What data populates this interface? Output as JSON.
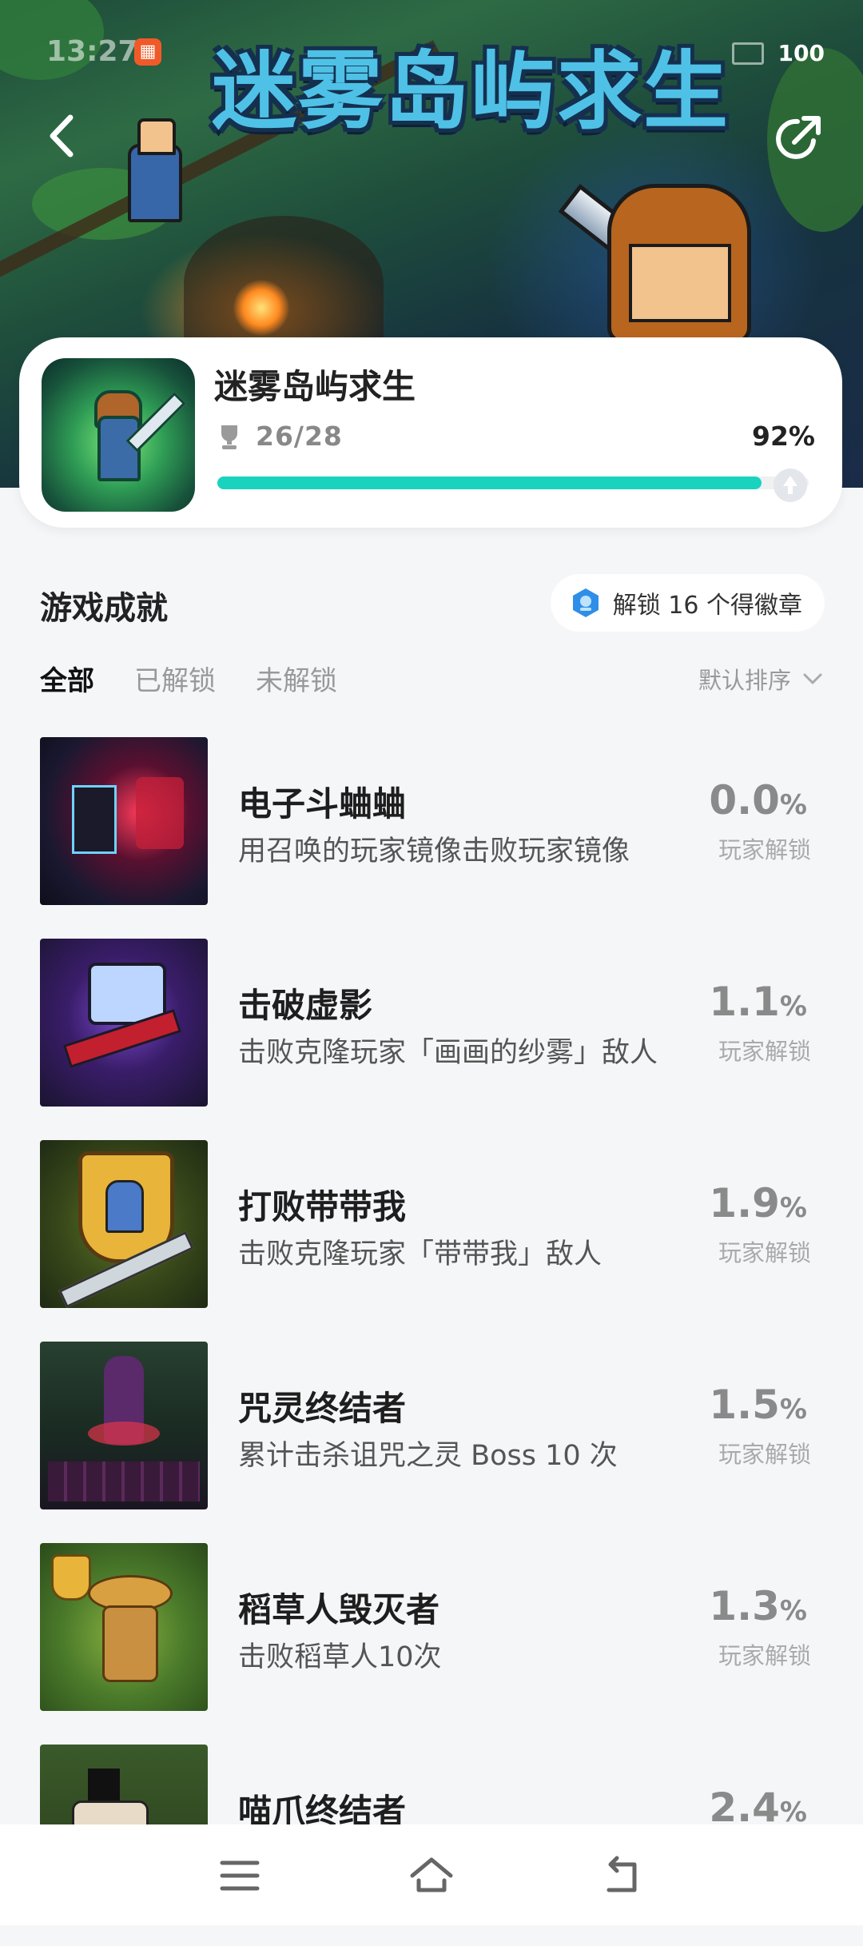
{
  "status": {
    "time": "13:27",
    "battery": "100"
  },
  "hero": {
    "title": "迷雾岛屿求生"
  },
  "game": {
    "name": "迷雾岛屿求生",
    "progress_text": "26/28",
    "percent_text": "92%",
    "progress": 0.92
  },
  "section": {
    "title": "游戏成就",
    "badge_text": "解锁 16 个得徽章"
  },
  "tabs": [
    {
      "label": "全部"
    },
    {
      "label": "已解锁"
    },
    {
      "label": "未解锁"
    }
  ],
  "sort": {
    "label": "默认排序"
  },
  "achievements": [
    {
      "name": "电子斗蛐蛐",
      "desc": "用召唤的玩家镜像击败玩家镜像",
      "pct": "0.0",
      "unit": "%",
      "sub": "玩家解锁"
    },
    {
      "name": "击破虚影",
      "desc": "击败克隆玩家「画画的纱雾」敌人",
      "pct": "1.1",
      "unit": "%",
      "sub": "玩家解锁"
    },
    {
      "name": "打败带带我",
      "desc": "击败克隆玩家「带带我」敌人",
      "pct": "1.9",
      "unit": "%",
      "sub": "玩家解锁"
    },
    {
      "name": "咒灵终结者",
      "desc": "累计击杀诅咒之灵 Boss 10 次",
      "pct": "1.5",
      "unit": "%",
      "sub": "玩家解锁"
    },
    {
      "name": "稻草人毁灭者",
      "desc": "击败稻草人10次",
      "pct": "1.3",
      "unit": "%",
      "sub": "玩家解锁"
    },
    {
      "name": "喵爪终结者",
      "desc": "",
      "pct": "2.4",
      "unit": "%",
      "sub": ""
    }
  ],
  "colors": {
    "accent": "#19d3be",
    "title_blue": "#4fc1e6"
  }
}
